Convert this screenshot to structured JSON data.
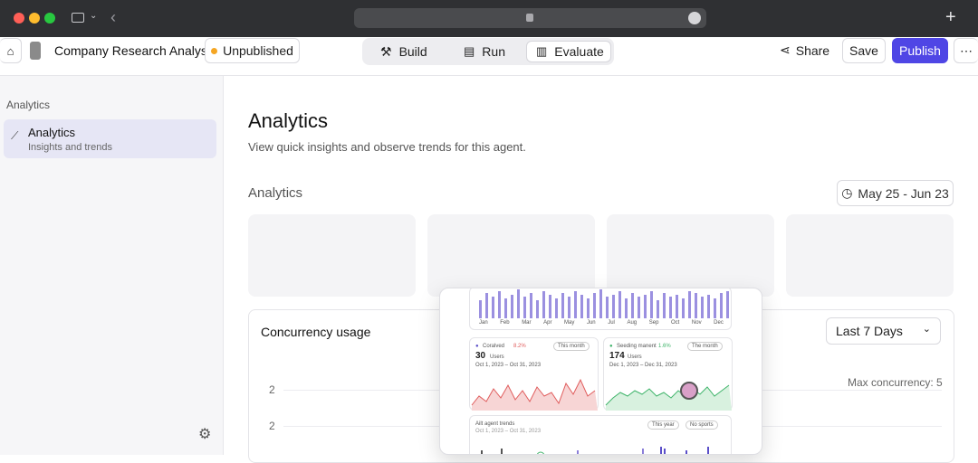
{
  "app": {
    "title": "Company Research Analyst",
    "status": "Unpublished",
    "tabs": [
      {
        "label": "Build"
      },
      {
        "label": "Run"
      },
      {
        "label": "Evaluate"
      }
    ],
    "share_label": "Share",
    "save_label": "Save",
    "publish_label": "Publish"
  },
  "sidebar": {
    "section": "Analytics",
    "items": [
      {
        "label": "Analytics",
        "sub": "Insights and trends"
      }
    ]
  },
  "main": {
    "title": "Analytics",
    "subtitle": "View quick insights and observe trends for this agent.",
    "section": "Analytics",
    "date_range": "May 25 - Jun 23",
    "concurrency": {
      "title": "Concurrency usage",
      "period": "Last 7 Days",
      "max_label": "Max concurrency: 5",
      "y_ticks": [
        "2",
        "2"
      ]
    }
  },
  "overlay": {
    "months": [
      "Jan",
      "Feb",
      "Mar",
      "Apr",
      "May",
      "Jun",
      "Jul",
      "Aug",
      "Sep",
      "Oct",
      "Nov",
      "Dec"
    ],
    "left": {
      "legend": "Coralved",
      "delta": "8.2%",
      "period": "This month",
      "value": "30",
      "unit": "Users",
      "range": "Oct 1, 2023 – Oct 31, 2023"
    },
    "right": {
      "legend": "Seeding manent",
      "delta": "1.6%",
      "period": "The month",
      "value": "174",
      "unit": "Users",
      "range": "Dec 1, 2023 – Dec 31, 2023"
    },
    "bottom": {
      "title": "Ailt agent trends",
      "range": "Oct 1, 2023 – Oct 31, 2023",
      "period": "This year",
      "filter": "No sports"
    }
  },
  "colors": {
    "accent": "#4f46e5",
    "status_dot": "#f5a623",
    "purple": "#8b7fd9",
    "red": "#e05c5c",
    "green": "#3fb46a"
  }
}
